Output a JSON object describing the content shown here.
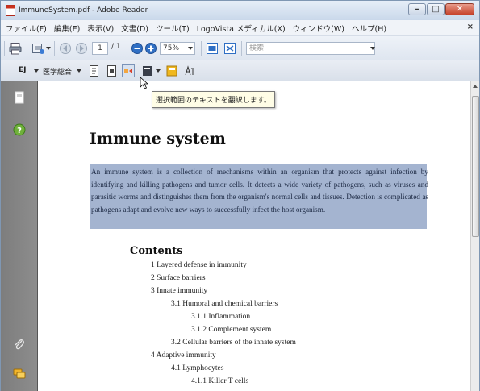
{
  "window": {
    "title": "ImmuneSystem.pdf - Adobe Reader",
    "minimize_glyph": "–",
    "maximize_glyph": "□",
    "close_glyph": "✕",
    "menu_close_glyph": "×"
  },
  "menu": [
    "ファイル(F)",
    "編集(E)",
    "表示(V)",
    "文書(D)",
    "ツール(T)",
    "LogoVista メディカル(X)",
    "ウィンドウ(W)",
    "ヘルプ(H)"
  ],
  "toolbar": {
    "page_current": "1",
    "page_total": "/ 1",
    "zoom": "75%",
    "search_placeholder": "検索"
  },
  "toolbar2": {
    "direction": "EJ",
    "dictionary": "医学総合"
  },
  "tooltip": "選択範囲のテキストを翻訳します。",
  "document": {
    "title": "Immune system",
    "intro": "An immune system is a collection of mechanisms within an organism that protects against infection by identifying and killing pathogens and tumor cells. It detects a wide variety of pathogens, such as viruses and parasitic worms and distinguishes them from the organism's normal cells and tissues. Detection is complicated as pathogens adapt and evolve new ways to successfully infect the host organism.",
    "contents_heading": "Contents",
    "toc": [
      "1 Layered defense in immunity",
      "2 Surface barriers",
      "3 Innate immunity",
      "3.1 Humoral and chemical barriers",
      "3.1.1 Inflammation",
      "3.1.2 Complement system",
      "3.2 Cellular barriers of the innate system",
      "4 Adaptive immunity",
      "4.1 Lymphocytes",
      "4.1.1 Killer T cells"
    ]
  },
  "colors": {
    "selection": "#a4b4d0",
    "nav_panel": "#858585",
    "title_bar": "#c9d8ea"
  }
}
